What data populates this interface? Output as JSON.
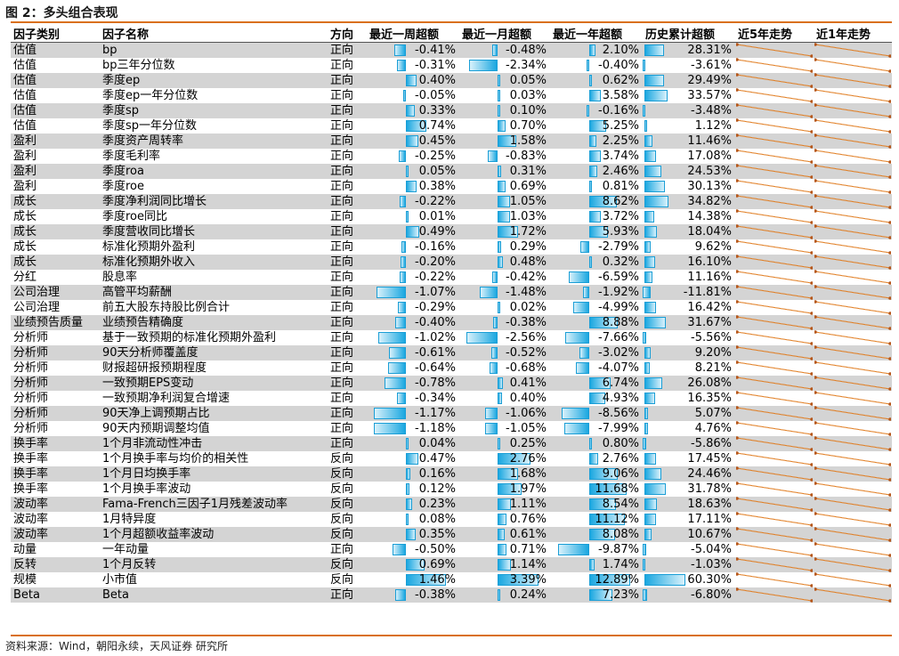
{
  "title": "图 2：多头组合表现",
  "source": "资料来源：Wind，朝阳永续，天风证券 研究所",
  "headers": [
    "因子类别",
    "因子名称",
    "方向",
    "最近一周超额",
    "最近一月超额",
    "最近一年超额",
    "历史累计超额",
    "近5年走势",
    "近1年走势"
  ],
  "colors": {
    "rule": "#d9701a",
    "bar": "#1aa7e0",
    "spark": "#e07b1e",
    "band": "#d4d4d4"
  },
  "rows": [
    {
      "cat": "估值",
      "name": "bp",
      "dir": "正向",
      "w": "-0.41%",
      "m": "-0.48%",
      "y": "2.10%",
      "c": "28.31%"
    },
    {
      "cat": "估值",
      "name": "bp三年分位数",
      "dir": "正向",
      "w": "-0.31%",
      "m": "-2.34%",
      "y": "-0.40%",
      "c": "-3.61%"
    },
    {
      "cat": "估值",
      "name": "季度ep",
      "dir": "正向",
      "w": "0.40%",
      "m": "0.05%",
      "y": "0.62%",
      "c": "29.49%"
    },
    {
      "cat": "估值",
      "name": "季度ep一年分位数",
      "dir": "正向",
      "w": "-0.05%",
      "m": "0.03%",
      "y": "3.58%",
      "c": "33.57%"
    },
    {
      "cat": "估值",
      "name": "季度sp",
      "dir": "正向",
      "w": "0.33%",
      "m": "0.10%",
      "y": "-0.16%",
      "c": "-3.48%"
    },
    {
      "cat": "估值",
      "name": "季度sp一年分位数",
      "dir": "正向",
      "w": "0.74%",
      "m": "0.70%",
      "y": "5.25%",
      "c": "1.12%"
    },
    {
      "cat": "盈利",
      "name": "季度资产周转率",
      "dir": "正向",
      "w": "0.45%",
      "m": "1.58%",
      "y": "2.25%",
      "c": "11.46%"
    },
    {
      "cat": "盈利",
      "name": "季度毛利率",
      "dir": "正向",
      "w": "-0.25%",
      "m": "-0.83%",
      "y": "3.74%",
      "c": "17.08%"
    },
    {
      "cat": "盈利",
      "name": "季度roa",
      "dir": "正向",
      "w": "0.05%",
      "m": "0.31%",
      "y": "2.46%",
      "c": "24.53%"
    },
    {
      "cat": "盈利",
      "name": "季度roe",
      "dir": "正向",
      "w": "0.38%",
      "m": "0.69%",
      "y": "0.81%",
      "c": "30.13%"
    },
    {
      "cat": "成长",
      "name": "季度净利润同比增长",
      "dir": "正向",
      "w": "-0.22%",
      "m": "1.05%",
      "y": "8.62%",
      "c": "34.82%"
    },
    {
      "cat": "成长",
      "name": "季度roe同比",
      "dir": "正向",
      "w": "0.01%",
      "m": "1.03%",
      "y": "3.72%",
      "c": "14.38%"
    },
    {
      "cat": "成长",
      "name": "季度营收同比增长",
      "dir": "正向",
      "w": "0.49%",
      "m": "1.72%",
      "y": "5.93%",
      "c": "18.04%"
    },
    {
      "cat": "成长",
      "name": "标准化预期外盈利",
      "dir": "正向",
      "w": "-0.16%",
      "m": "0.29%",
      "y": "-2.79%",
      "c": "9.62%"
    },
    {
      "cat": "成长",
      "name": "标准化预期外收入",
      "dir": "正向",
      "w": "-0.20%",
      "m": "0.48%",
      "y": "0.32%",
      "c": "16.10%"
    },
    {
      "cat": "分红",
      "name": "股息率",
      "dir": "正向",
      "w": "-0.22%",
      "m": "-0.42%",
      "y": "-6.59%",
      "c": "11.16%"
    },
    {
      "cat": "公司治理",
      "name": "高管平均薪酬",
      "dir": "正向",
      "w": "-1.07%",
      "m": "-1.48%",
      "y": "-1.92%",
      "c": "-11.81%"
    },
    {
      "cat": "公司治理",
      "name": "前五大股东持股比例合计",
      "dir": "正向",
      "w": "-0.29%",
      "m": "0.02%",
      "y": "-4.99%",
      "c": "16.42%"
    },
    {
      "cat": "业绩预告质量",
      "name": "业绩预告精确度",
      "dir": "正向",
      "w": "-0.40%",
      "m": "-0.38%",
      "y": "8.88%",
      "c": "31.67%"
    },
    {
      "cat": "分析师",
      "name": "基于一致预期的标准化预期外盈利",
      "dir": "正向",
      "w": "-1.02%",
      "m": "-2.56%",
      "y": "-7.66%",
      "c": "-5.56%"
    },
    {
      "cat": "分析师",
      "name": "90天分析师覆盖度",
      "dir": "正向",
      "w": "-0.61%",
      "m": "-0.52%",
      "y": "-3.02%",
      "c": "9.20%"
    },
    {
      "cat": "分析师",
      "name": "财报超研报预期程度",
      "dir": "正向",
      "w": "-0.64%",
      "m": "-0.68%",
      "y": "-4.07%",
      "c": "8.21%"
    },
    {
      "cat": "分析师",
      "name": "一致预期EPS变动",
      "dir": "正向",
      "w": "-0.78%",
      "m": "0.41%",
      "y": "6.74%",
      "c": "26.08%"
    },
    {
      "cat": "分析师",
      "name": "一致预期净利润复合增速",
      "dir": "正向",
      "w": "-0.34%",
      "m": "0.40%",
      "y": "4.93%",
      "c": "16.35%"
    },
    {
      "cat": "分析师",
      "name": "90天净上调预期占比",
      "dir": "正向",
      "w": "-1.17%",
      "m": "-1.06%",
      "y": "-8.56%",
      "c": "5.07%"
    },
    {
      "cat": "分析师",
      "name": "90天内预期调整均值",
      "dir": "正向",
      "w": "-1.18%",
      "m": "-1.05%",
      "y": "-7.99%",
      "c": "4.76%"
    },
    {
      "cat": "换手率",
      "name": "1个月非流动性冲击",
      "dir": "正向",
      "w": "0.04%",
      "m": "0.25%",
      "y": "0.80%",
      "c": "-5.86%"
    },
    {
      "cat": "换手率",
      "name": "1个月换手率与均价的相关性",
      "dir": "反向",
      "w": "0.47%",
      "m": "2.76%",
      "y": "2.76%",
      "c": "17.45%"
    },
    {
      "cat": "换手率",
      "name": "1个月日均换手率",
      "dir": "反向",
      "w": "0.16%",
      "m": "1.68%",
      "y": "9.06%",
      "c": "24.46%"
    },
    {
      "cat": "换手率",
      "name": "1个月换手率波动",
      "dir": "反向",
      "w": "0.12%",
      "m": "1.97%",
      "y": "11.68%",
      "c": "31.78%"
    },
    {
      "cat": "波动率",
      "name": "Fama-French三因子1月残差波动率",
      "dir": "反向",
      "w": "0.23%",
      "m": "1.11%",
      "y": "8.54%",
      "c": "18.63%"
    },
    {
      "cat": "波动率",
      "name": "1月特异度",
      "dir": "反向",
      "w": "0.08%",
      "m": "0.76%",
      "y": "11.12%",
      "c": "17.11%"
    },
    {
      "cat": "波动率",
      "name": "1个月超额收益率波动",
      "dir": "反向",
      "w": "0.35%",
      "m": "0.61%",
      "y": "8.08%",
      "c": "10.67%"
    },
    {
      "cat": "动量",
      "name": "一年动量",
      "dir": "正向",
      "w": "-0.50%",
      "m": "0.71%",
      "y": "-9.87%",
      "c": "-5.04%"
    },
    {
      "cat": "反转",
      "name": "1个月反转",
      "dir": "反向",
      "w": "0.69%",
      "m": "1.14%",
      "y": "1.74%",
      "c": "-1.03%"
    },
    {
      "cat": "规模",
      "name": "小市值",
      "dir": "反向",
      "w": "1.46%",
      "m": "3.39%",
      "y": "12.89%",
      "c": "60.30%"
    },
    {
      "cat": "Beta",
      "name": "Beta",
      "dir": "正向",
      "w": "-0.38%",
      "m": "0.24%",
      "y": "7.23%",
      "c": "-6.80%"
    }
  ]
}
